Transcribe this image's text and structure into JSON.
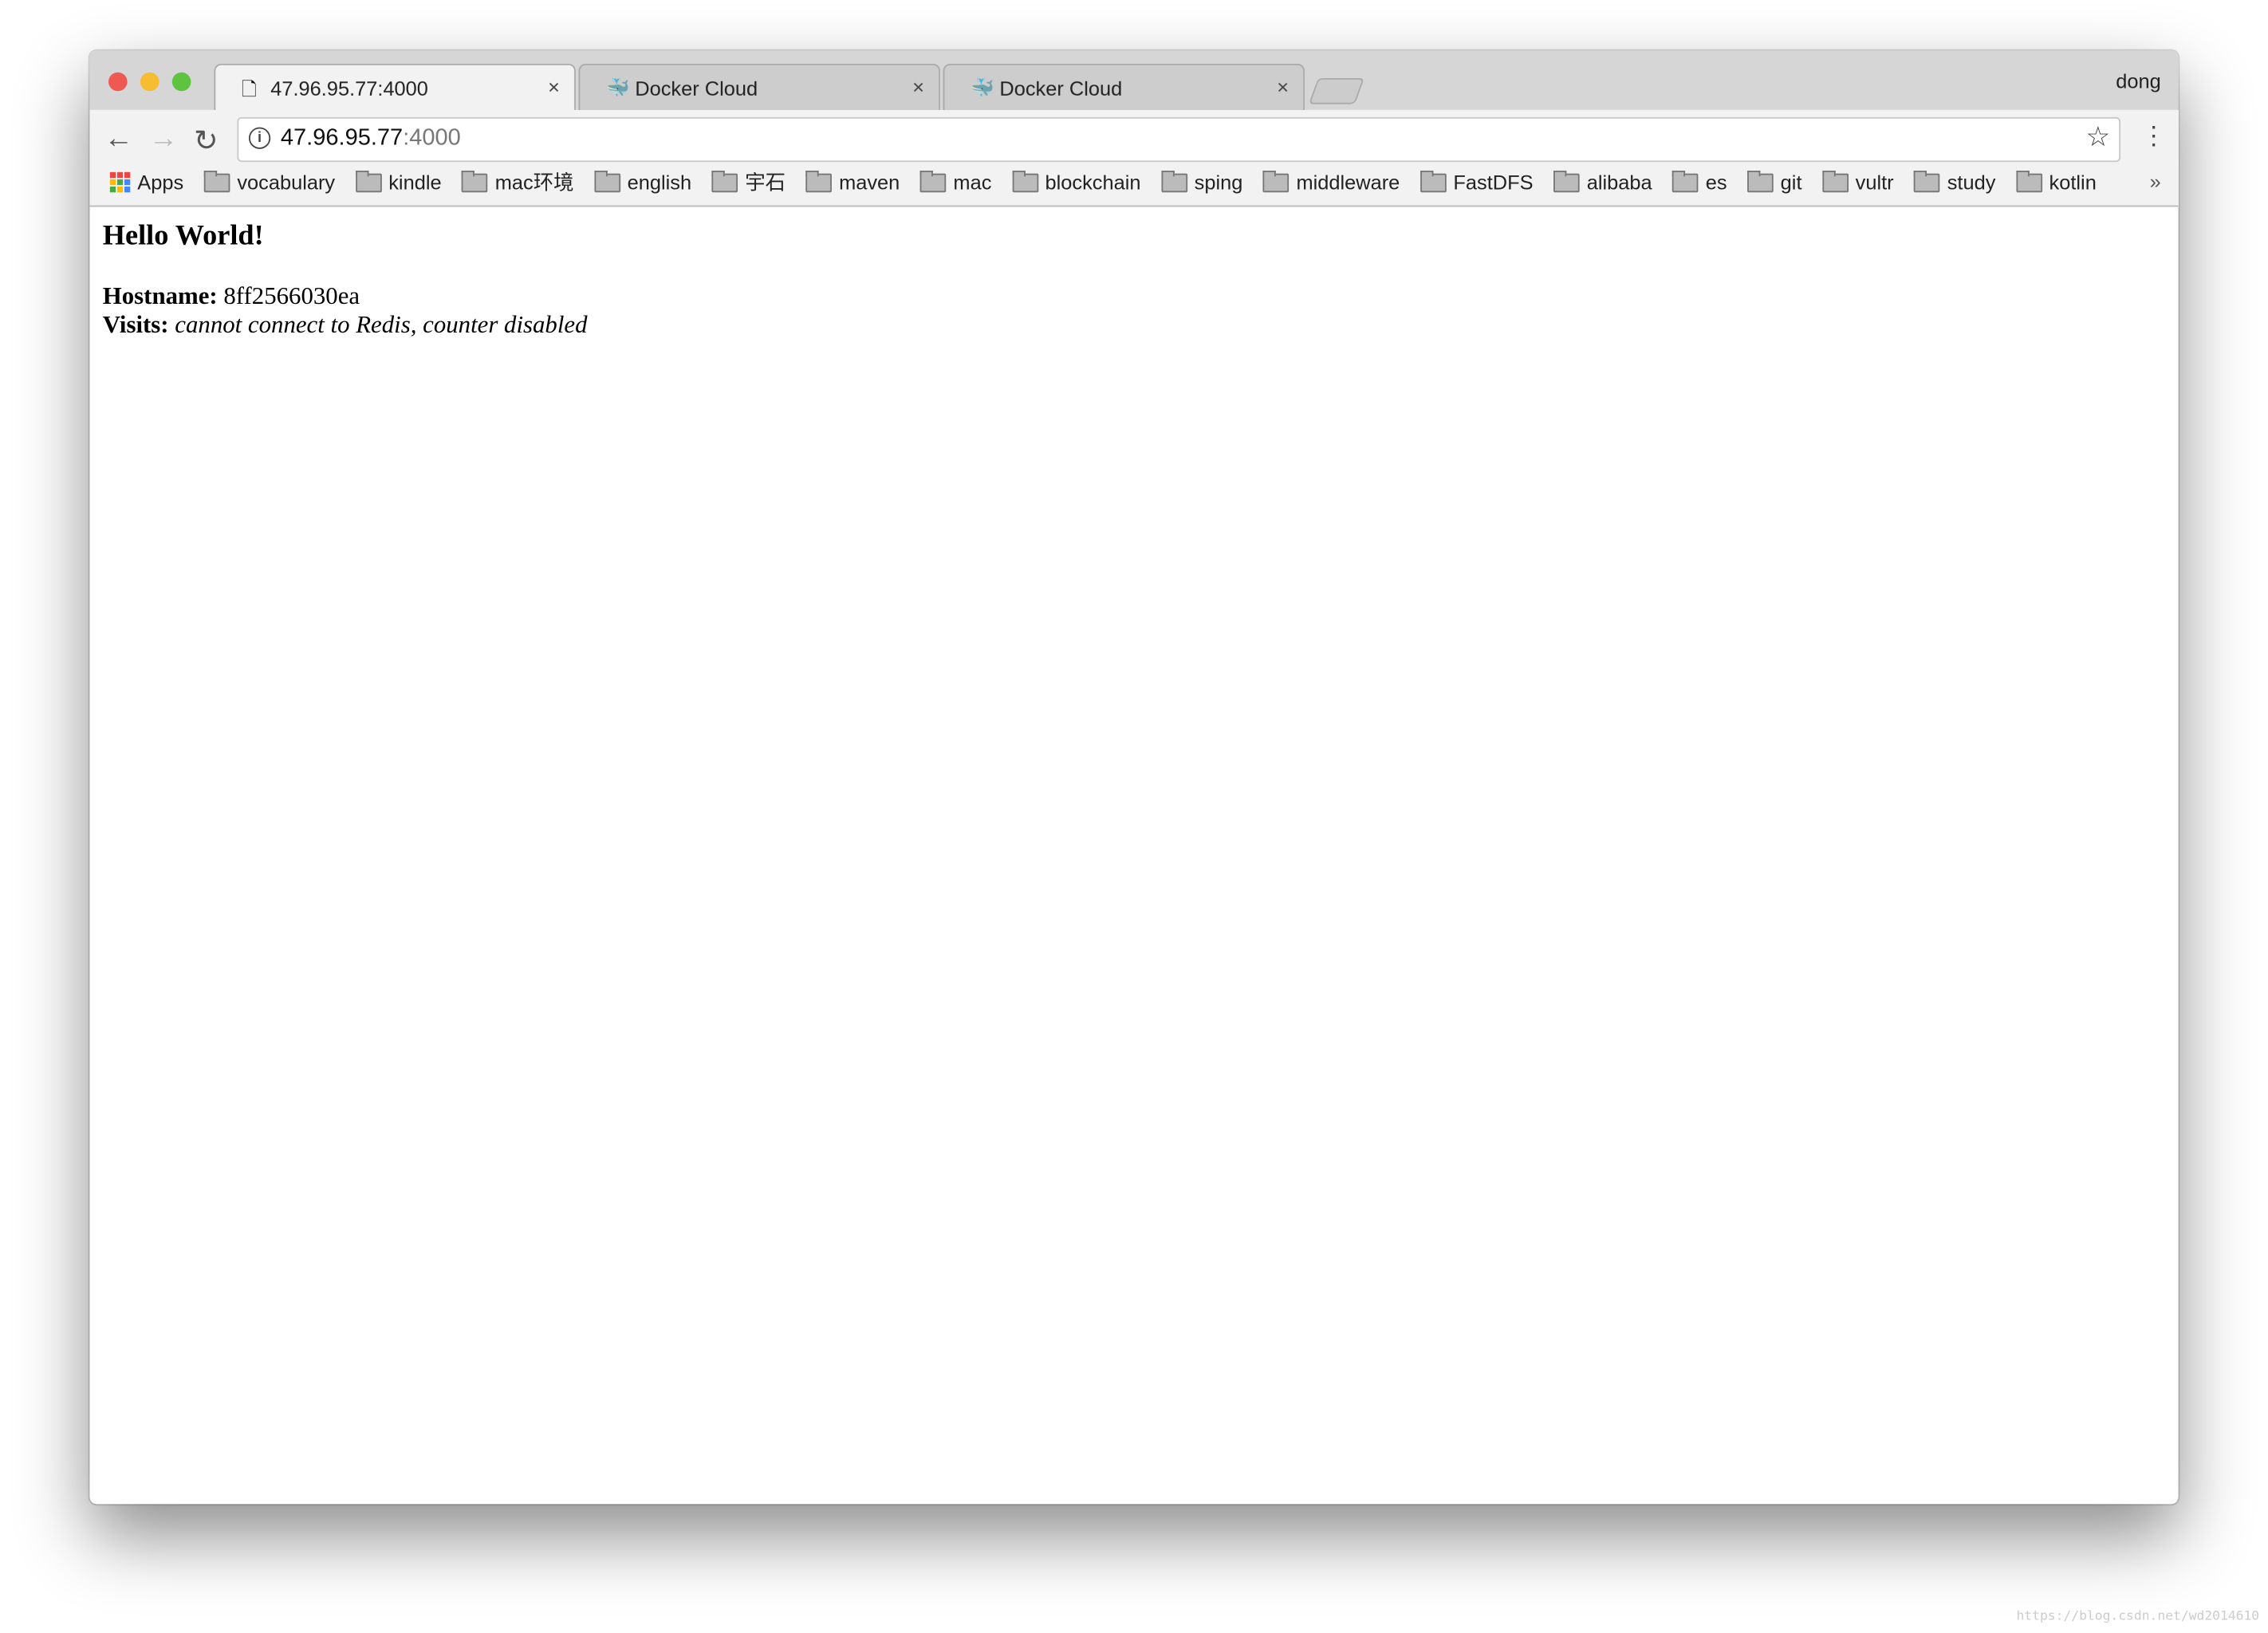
{
  "browser": {
    "tabs": [
      {
        "title": "47.96.95.77:4000",
        "icon": "page-icon",
        "active": true
      },
      {
        "title": "Docker Cloud",
        "icon": "docker-whale-icon",
        "active": false
      },
      {
        "title": "Docker Cloud",
        "icon": "docker-whale-icon",
        "active": false
      }
    ],
    "close_glyph": "×",
    "user": "dong",
    "address": {
      "host": "47.96.95.77",
      "port": ":4000"
    },
    "bookmarks": [
      "Apps",
      "vocabulary",
      "kindle",
      "mac环境",
      "english",
      "宇石",
      "maven",
      "mac",
      "blockchain",
      "sping",
      "middleware",
      "FastDFS",
      "alibaba",
      "es",
      "git",
      "vultr",
      "study",
      "kotlin"
    ],
    "more": "»"
  },
  "page": {
    "heading": "Hello World!",
    "hostname_label": "Hostname:",
    "hostname_value": "8ff2566030ea",
    "visits_label": "Visits:",
    "visits_value": "cannot connect to Redis, counter disabled"
  },
  "watermark": "https://blog.csdn.net/wd2014610",
  "colors": {
    "close": "#ee5a52",
    "minimize": "#f5bd2f",
    "maximize": "#5ec440",
    "docker": "#2496ed"
  }
}
